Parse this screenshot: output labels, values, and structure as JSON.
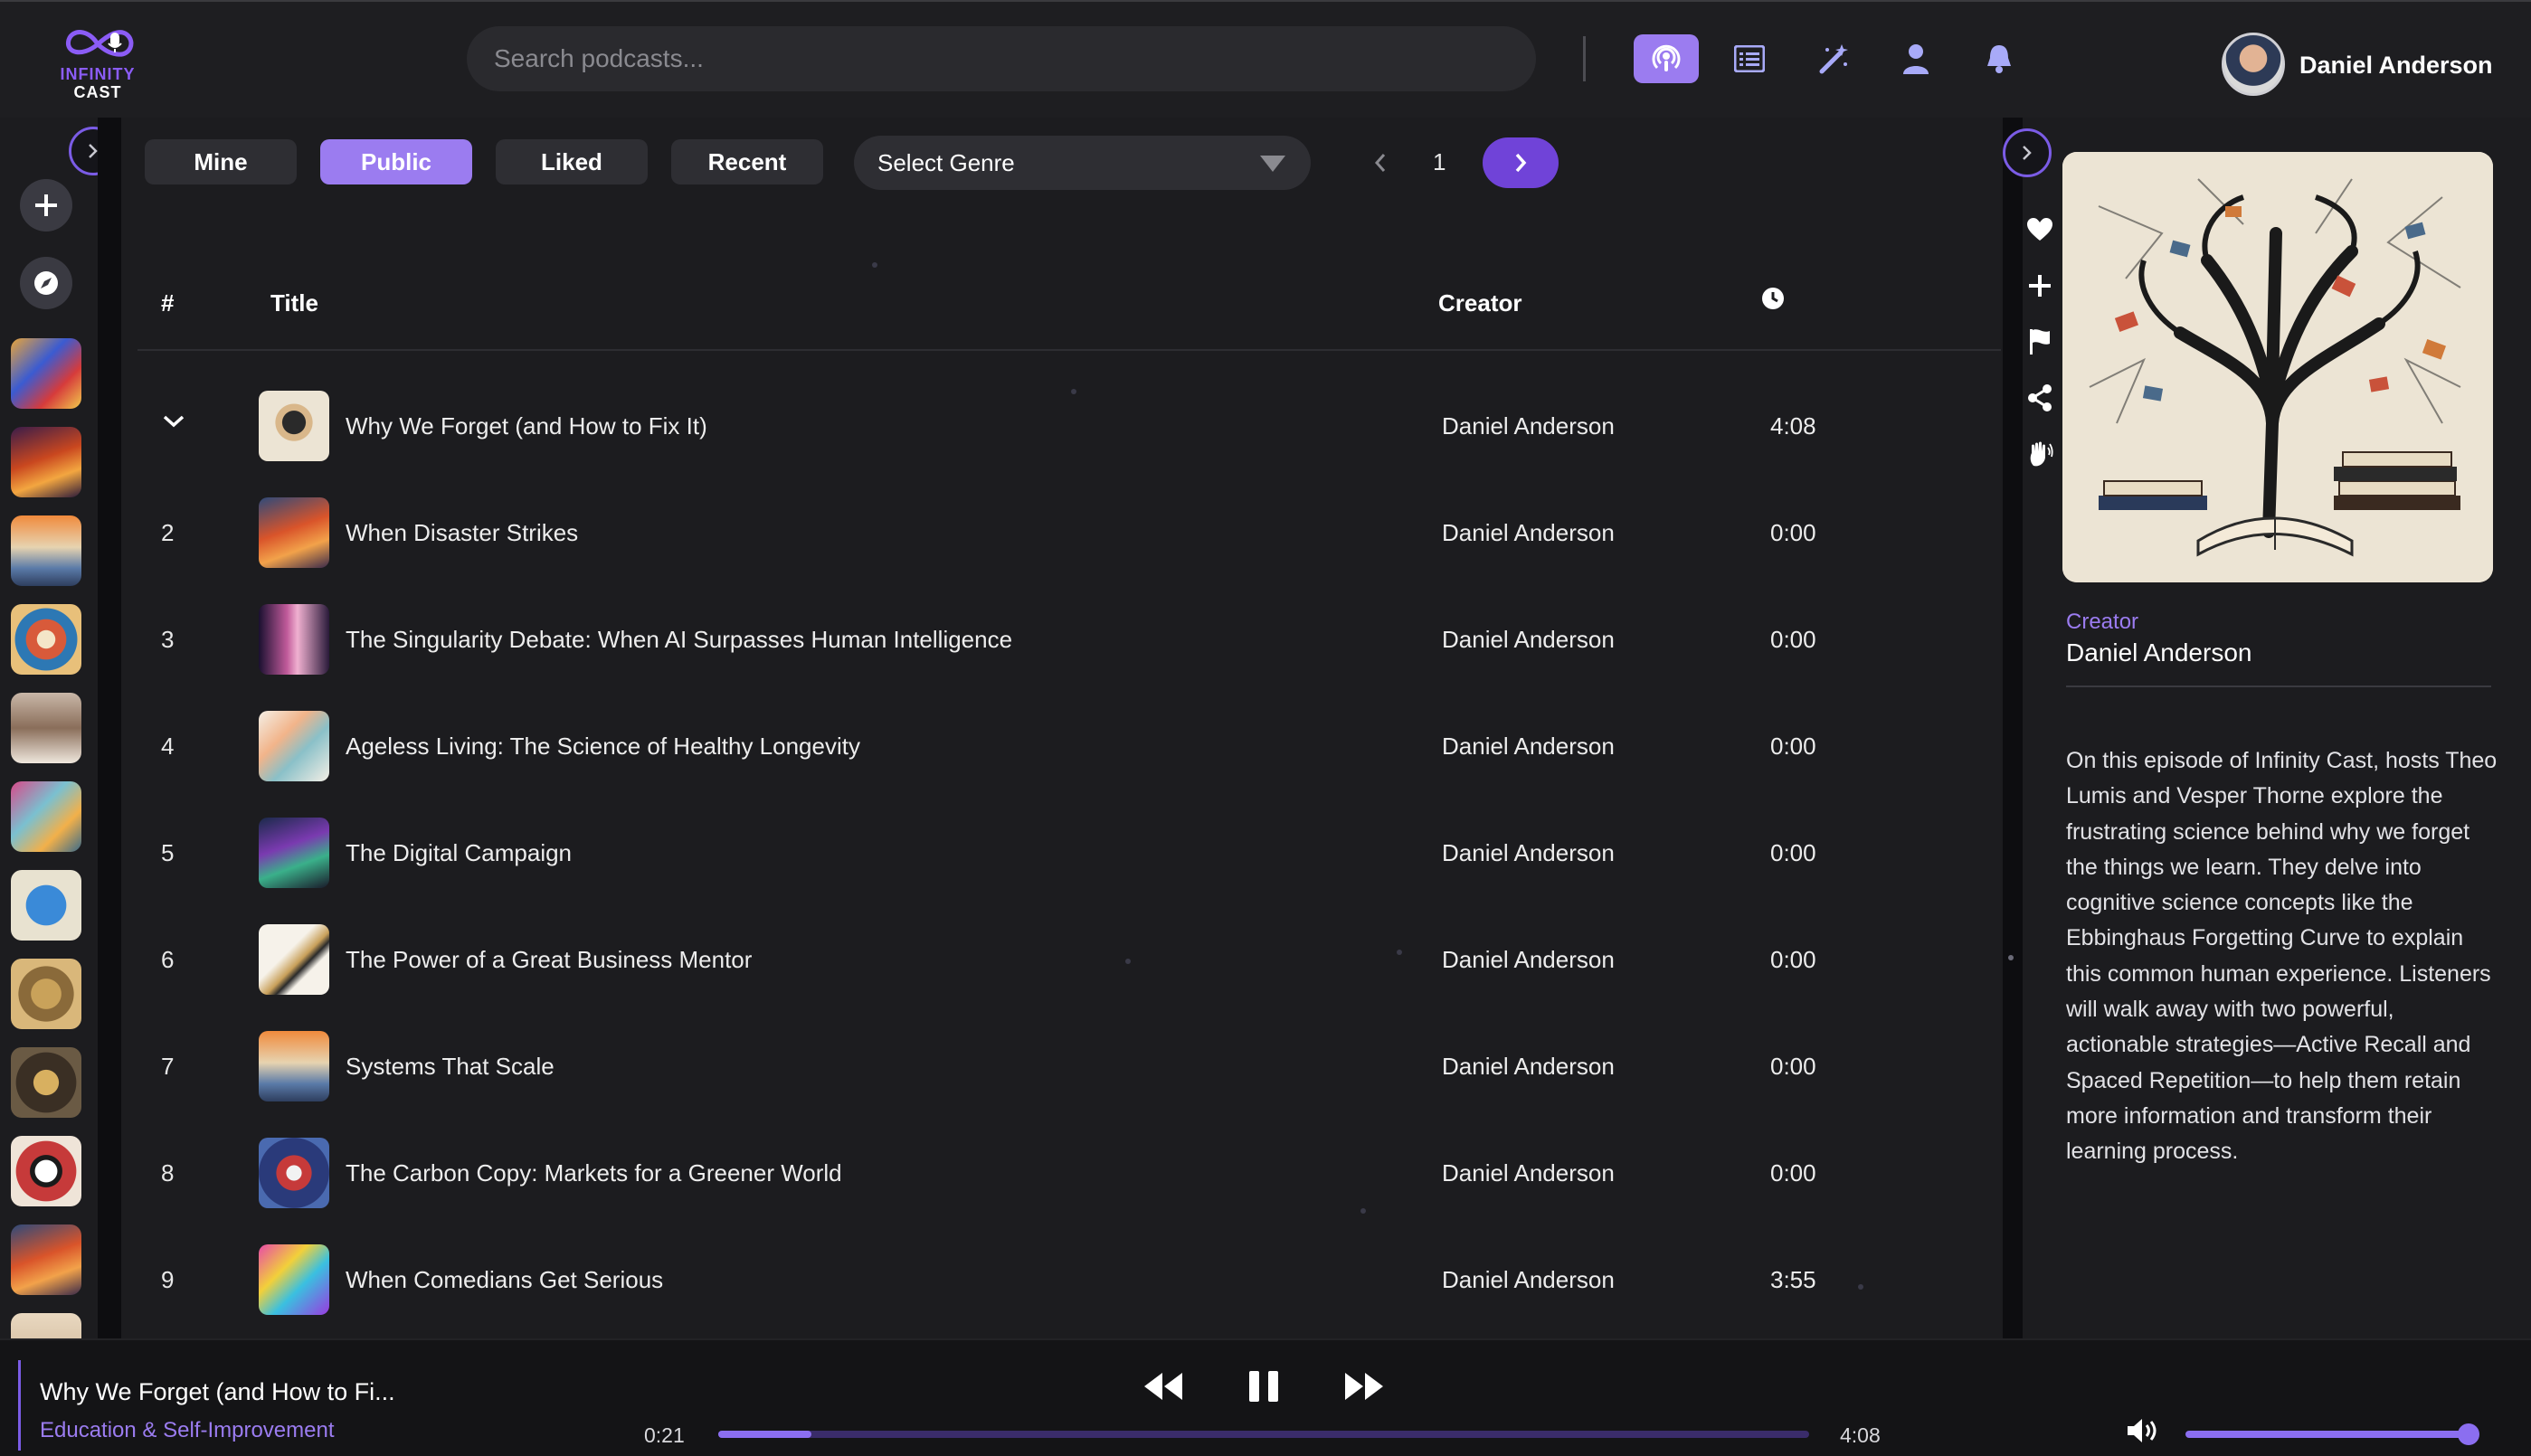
{
  "app": {
    "logo_line1": "INFINITY",
    "logo_line2": "CAST"
  },
  "search": {
    "placeholder": "Search podcasts..."
  },
  "top_icons": [
    "podcast-icon",
    "list-icon",
    "magic-wand-icon",
    "user-icon",
    "bell-icon"
  ],
  "user": {
    "name": "Daniel Anderson"
  },
  "filters": {
    "mine": "Mine",
    "public": "Public",
    "liked": "Liked",
    "recent": "Recent",
    "active": "Public"
  },
  "genre": {
    "placeholder": "Select Genre"
  },
  "pagination": {
    "page": "1"
  },
  "table": {
    "headers": {
      "num": "#",
      "title": "Title",
      "creator": "Creator"
    },
    "rows": [
      {
        "num": "",
        "title": "Why We Forget (and How to Fix It)",
        "creator": "Daniel Anderson",
        "duration": "4:08"
      },
      {
        "num": "2",
        "title": "When Disaster Strikes",
        "creator": "Daniel Anderson",
        "duration": "0:00"
      },
      {
        "num": "3",
        "title": "The Singularity Debate: When AI Surpasses Human Intelligence",
        "creator": "Daniel Anderson",
        "duration": "0:00"
      },
      {
        "num": "4",
        "title": "Ageless Living: The Science of Healthy Longevity",
        "creator": "Daniel Anderson",
        "duration": "0:00"
      },
      {
        "num": "5",
        "title": "The Digital Campaign",
        "creator": "Daniel Anderson",
        "duration": "0:00"
      },
      {
        "num": "6",
        "title": "The Power of a Great Business Mentor",
        "creator": "Daniel Anderson",
        "duration": "0:00"
      },
      {
        "num": "7",
        "title": "Systems That Scale",
        "creator": "Daniel Anderson",
        "duration": "0:00"
      },
      {
        "num": "8",
        "title": "The Carbon Copy: Markets for a Greener World",
        "creator": "Daniel Anderson",
        "duration": "0:00"
      },
      {
        "num": "9",
        "title": "When Comedians Get Serious",
        "creator": "Daniel Anderson",
        "duration": "3:55"
      }
    ]
  },
  "details": {
    "creator_label": "Creator",
    "creator_name": "Daniel Anderson",
    "description": "On this episode of Infinity Cast, hosts Theo Lumis and Vesper Thorne explore the frustrating science behind why we forget the things we learn. They delve into cognitive science concepts like the Ebbinghaus Forgetting Curve to explain this common human experience. Listeners will walk away with two powerful, actionable strategies—Active Recall and Spaced Repetition—to help them retain more information and transform their learning process."
  },
  "player": {
    "title": "Why We Forget (and How to Fi...",
    "genre": "Education & Self-Improvement",
    "elapsed": "0:21",
    "total": "4:08",
    "progress_fraction": 0.085,
    "volume_fraction": 1.0
  },
  "colors": {
    "accent": "#9b7cf0",
    "accent_dark": "#7043d8",
    "background": "#1c1c1f"
  }
}
